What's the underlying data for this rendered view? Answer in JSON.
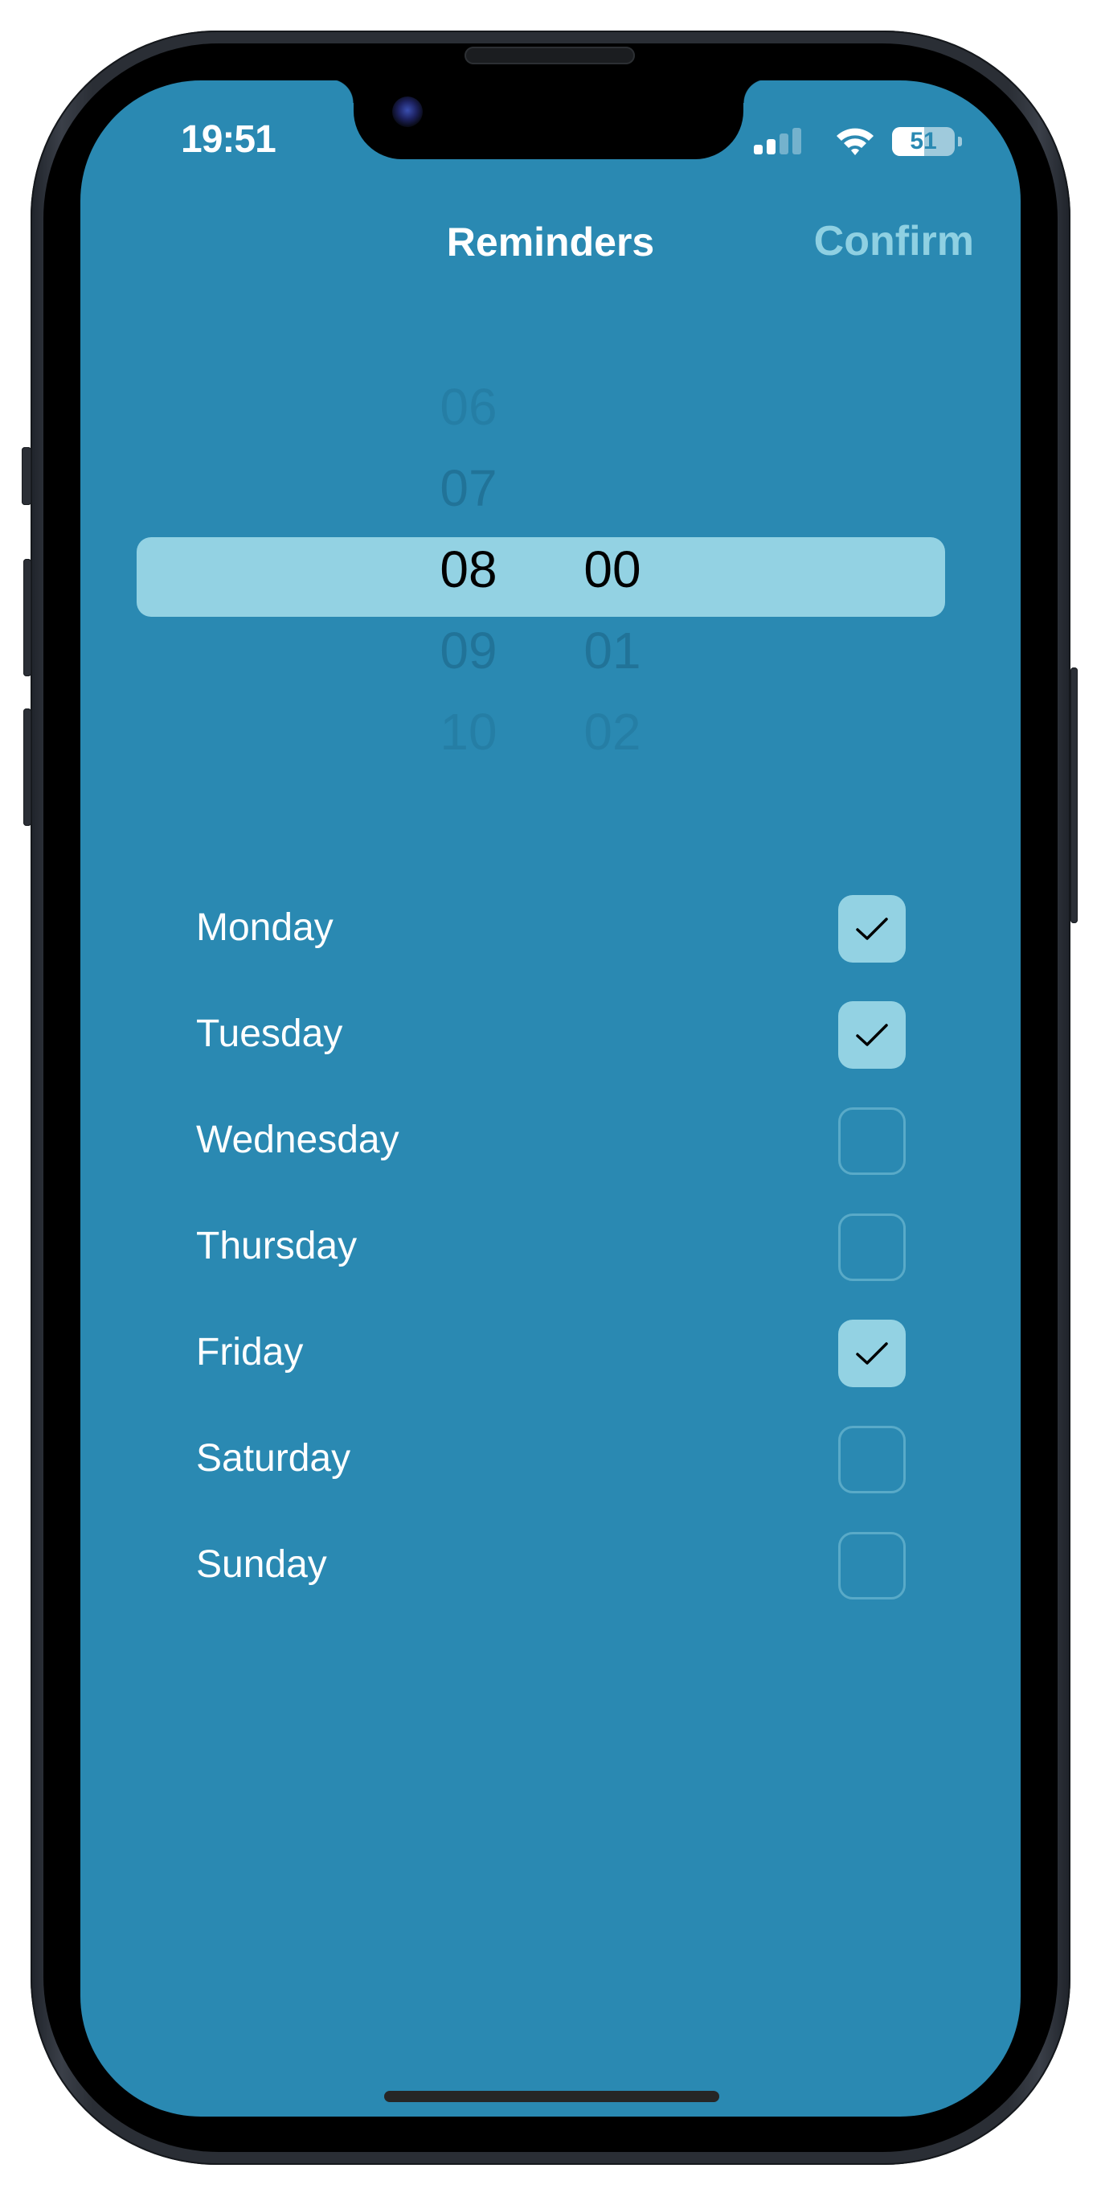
{
  "status_bar": {
    "time": "19:51",
    "signal_bars_active": 2,
    "signal_bars_total": 4,
    "wifi_icon": "wifi-icon",
    "battery_percent": 51,
    "battery_label": "51"
  },
  "nav": {
    "title": "Reminders",
    "confirm_label": "Confirm"
  },
  "picker": {
    "hours": [
      "06",
      "07",
      "08",
      "09",
      "10"
    ],
    "minutes": [
      "",
      "",
      "00",
      "01",
      "02"
    ],
    "selected_hour": "08",
    "selected_minute": "00"
  },
  "days": [
    {
      "label": "Monday",
      "checked": true
    },
    {
      "label": "Tuesday",
      "checked": true
    },
    {
      "label": "Wednesday",
      "checked": false
    },
    {
      "label": "Thursday",
      "checked": false
    },
    {
      "label": "Friday",
      "checked": true
    },
    {
      "label": "Saturday",
      "checked": false
    },
    {
      "label": "Sunday",
      "checked": false
    }
  ],
  "colors": {
    "background": "#2A89B2",
    "accent": "#93D2E3",
    "confirm": "#8FD0E2"
  }
}
